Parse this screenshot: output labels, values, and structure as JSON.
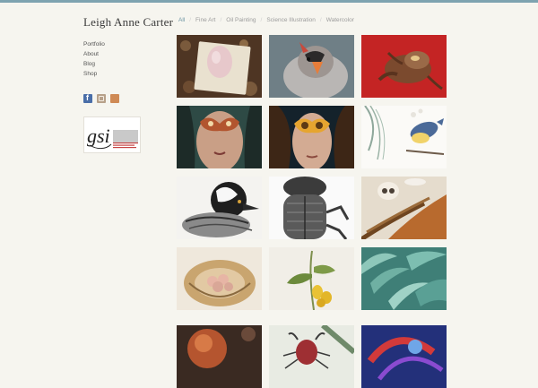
{
  "site": {
    "title": "Leigh Anne Carter"
  },
  "filters": {
    "all": "All",
    "separator": "/",
    "fine_art": "Fine Art",
    "oil_painting": "Oil Painting",
    "science_illustration": "Science Illustration",
    "watercolor": "Watercolor"
  },
  "nav": {
    "portfolio": "Portfolio",
    "about": "About",
    "blog": "Blog",
    "shop": "Shop"
  },
  "social": [
    "facebook-icon",
    "instagram-icon",
    "flickr-icon"
  ],
  "badge": {
    "monogram": "gsi"
  },
  "colors": {
    "accent_topbar": "#7ea3b0",
    "active_filter": "#6d95a3",
    "page_bg": "#f6f5ef"
  }
}
